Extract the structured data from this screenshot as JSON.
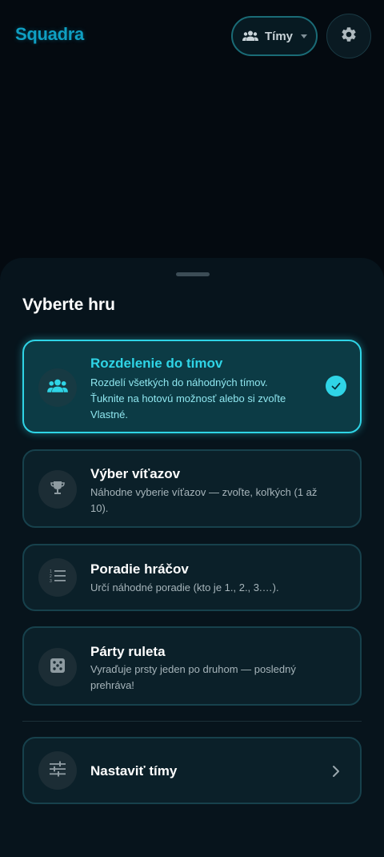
{
  "app": {
    "name": "Squadra"
  },
  "header": {
    "team_select_label": "Tímy",
    "settings_icon": "gear-icon"
  },
  "sheet": {
    "title": "Vyberte hru",
    "games": [
      {
        "title": "Rozdelenie do tímov",
        "description_lines": [
          "Rozdelí všetkých do náhodných tímov.",
          "Ťuknite na hotovú možnosť alebo si zvoľte",
          "Vlastné."
        ],
        "icon": "groups-icon",
        "selected": true
      },
      {
        "title": "Výber víťazov",
        "description_lines": [
          "Náhodne vyberie víťazov — zvoľte, koľkých (1 až",
          "10)."
        ],
        "icon": "trophy-icon",
        "selected": false
      },
      {
        "title": "Poradie hráčov",
        "description_lines": [
          "Určí náhodné poradie (kto je 1., 2., 3.…)."
        ],
        "icon": "numbered-list-icon",
        "selected": false
      },
      {
        "title": "Párty ruleta",
        "description_lines": [
          "Vyraďuje prsty jeden po druhom — posledný",
          "prehráva!"
        ],
        "icon": "dice-icon",
        "selected": false
      }
    ],
    "configure": {
      "label": "Nastaviť tímy",
      "icon": "tune-icon"
    }
  },
  "colors": {
    "accent": "#2fd4e6",
    "background": "#040a10",
    "sheet": "#07141c",
    "card": "#0b2029",
    "selected_card": "#0c3b45",
    "logo": "#0f9fc2"
  }
}
